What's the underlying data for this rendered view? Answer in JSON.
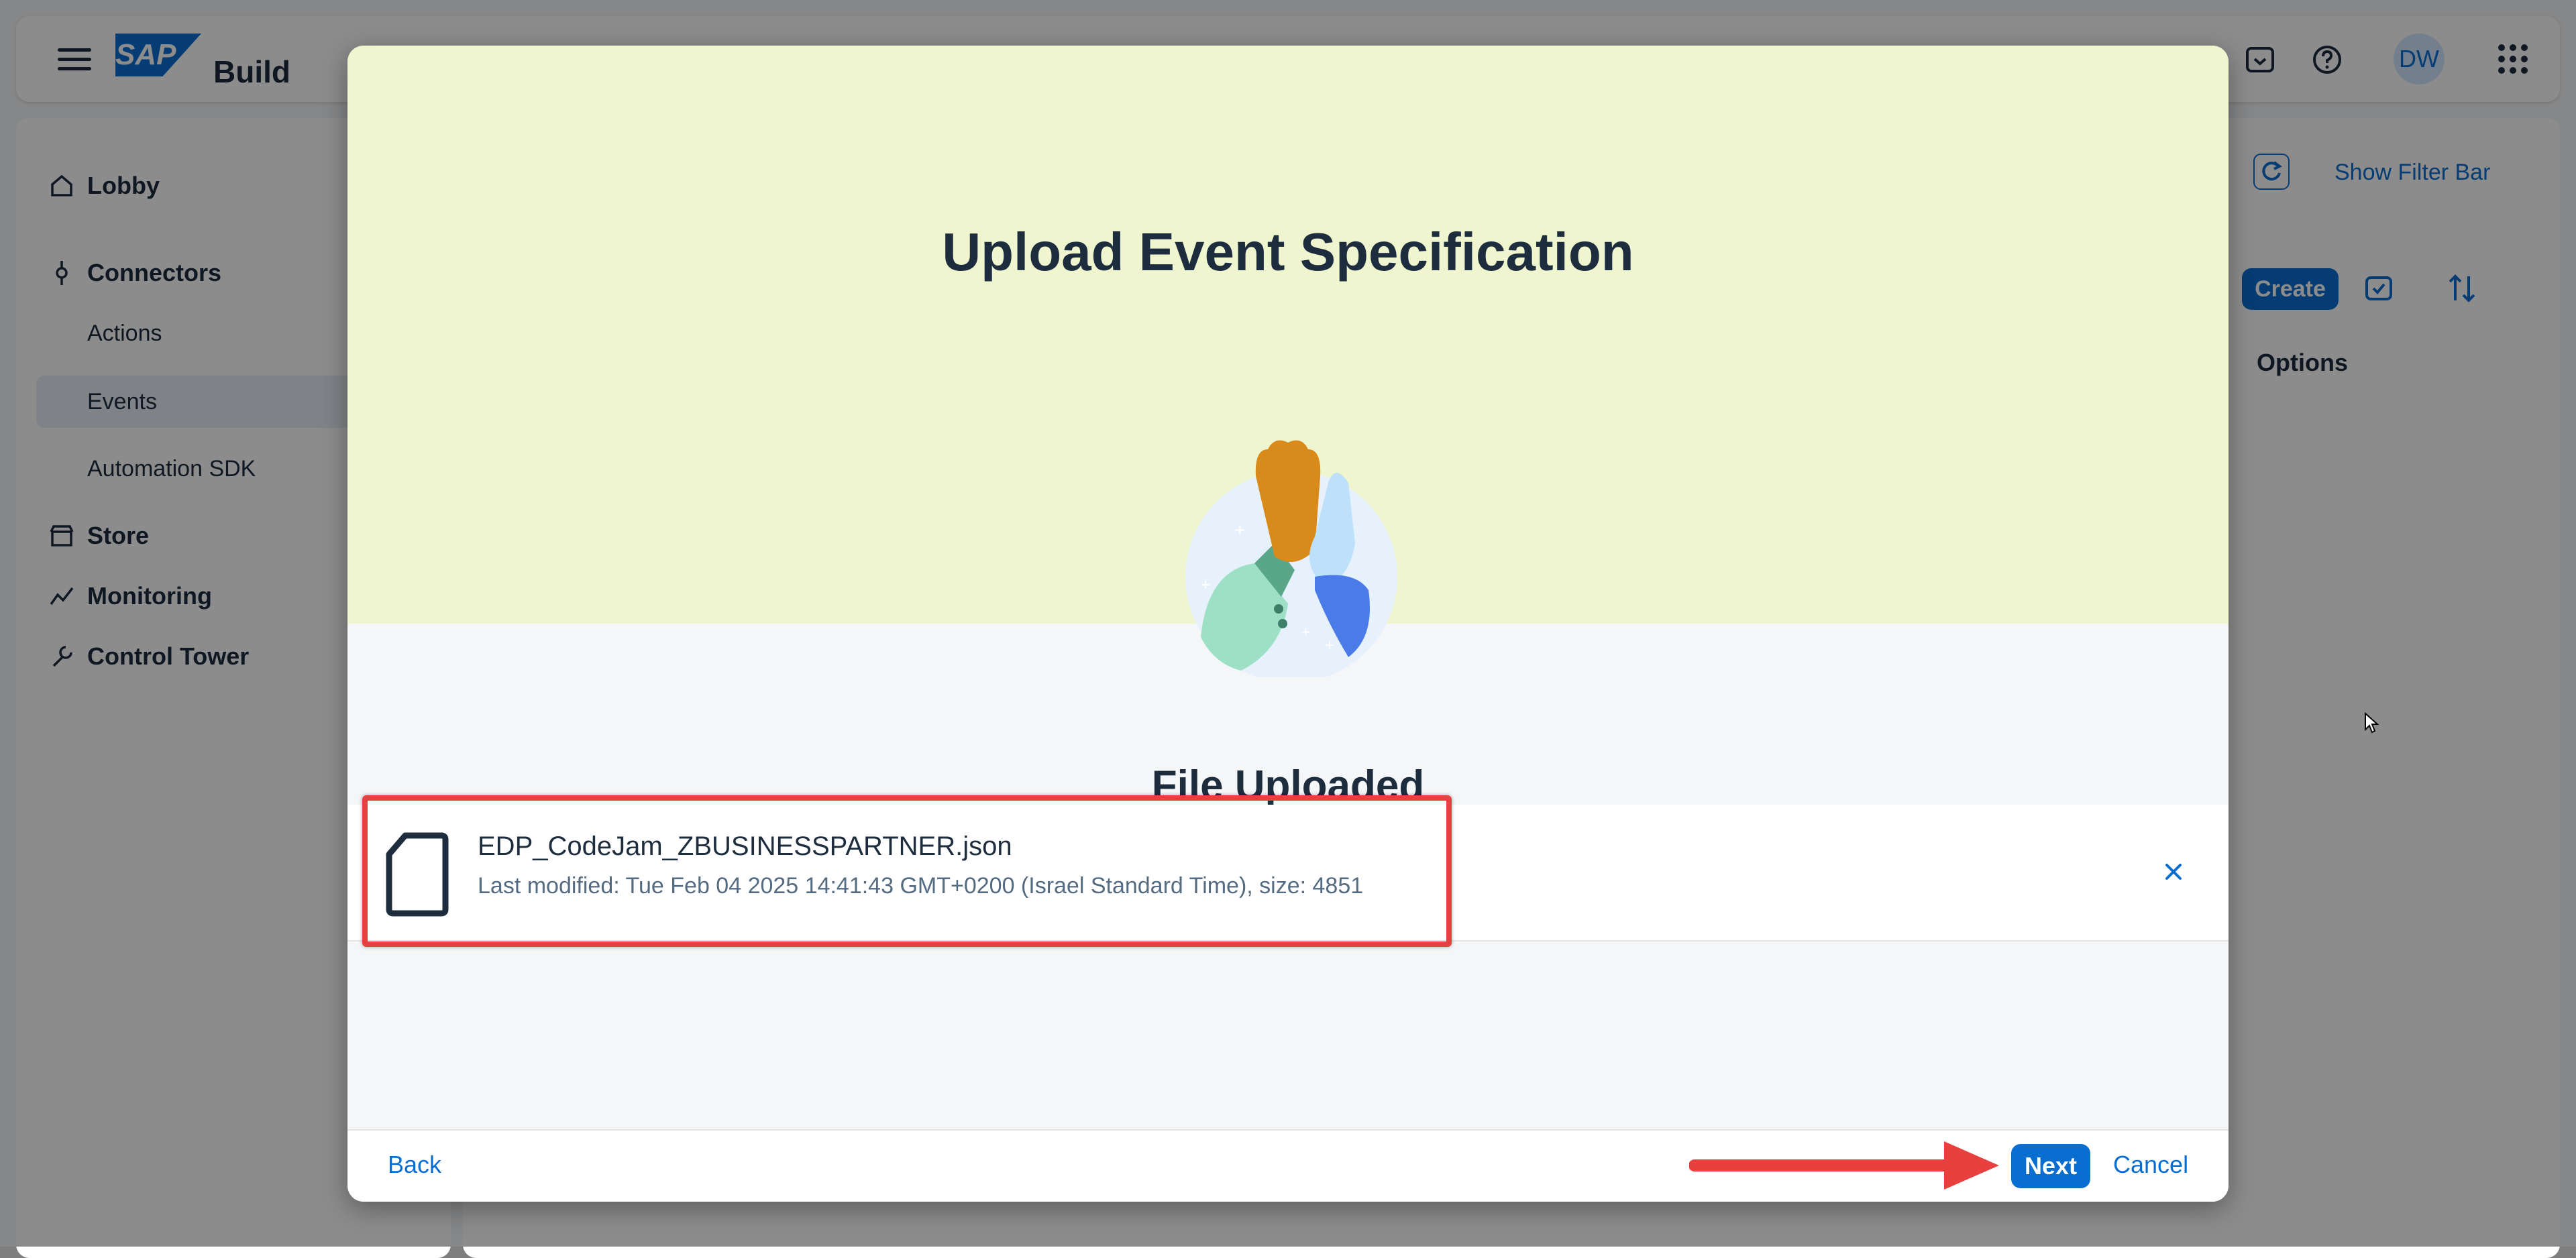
{
  "shell": {
    "product_name": "Build",
    "logo_text": "SAP",
    "avatar_initials": "DW"
  },
  "sidebar": {
    "items": [
      {
        "label": "Lobby",
        "icon": "home-icon"
      },
      {
        "label": "Connectors",
        "icon": "connector-icon"
      },
      {
        "label": "Actions"
      },
      {
        "label": "Events"
      },
      {
        "label": "Automation SDK"
      },
      {
        "label": "Store",
        "icon": "store-icon"
      },
      {
        "label": "Monitoring",
        "icon": "monitoring-icon"
      },
      {
        "label": "Control Tower",
        "icon": "wrench-icon"
      }
    ]
  },
  "main": {
    "show_filter_bar_label": "Show Filter Bar",
    "create_label": "Create",
    "options_header": "Options"
  },
  "dialog": {
    "title": "Upload Event Specification",
    "status_title": "File Uploaded",
    "file": {
      "name": "EDP_CodeJam_ZBUSINESSPARTNER.json",
      "meta": "Last modified: Tue Feb 04 2025 14:41:43 GMT+0200 (Israel Standard Time), size: 4851"
    },
    "back_label": "Back",
    "next_label": "Next",
    "cancel_label": "Cancel"
  },
  "colors": {
    "accent": "#0a6ed1",
    "header_bg": "#eff5cf",
    "annotation_red": "#e8403f"
  }
}
